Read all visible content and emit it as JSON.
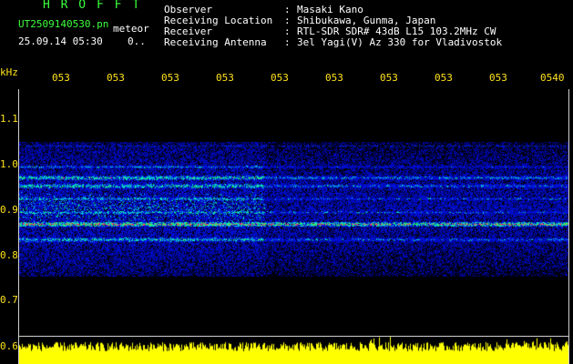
{
  "header": {
    "app_title": "H R O F F T",
    "filename": "UT2509140530.pn",
    "type_label": "meteor",
    "timestamp": "25.09.14 05:30",
    "count_label": "0..",
    "fields": [
      {
        "label": "Observer",
        "colon": ":",
        "value": "Masaki Kano"
      },
      {
        "label": "Receiving Location",
        "colon": ":",
        "value": "Shibukawa, Gunma, Japan"
      },
      {
        "label": "Receiver",
        "colon": ":",
        "value": "RTL-SDR SDR# 43dB L15 103.2MHz CW"
      },
      {
        "label": "Receiving Antenna",
        "colon": ":",
        "value": "3el Yagi(V) Az 330 for Vladivostok"
      }
    ]
  },
  "time_axis": {
    "labels": [
      "053",
      "053",
      "053",
      "053",
      "053",
      "053",
      "053",
      "053",
      "053",
      "0540"
    ]
  },
  "freq_axis": {
    "unit": "kHz",
    "ticks": [
      "1.1",
      "1.0",
      "0.9",
      "0.8",
      "0.7",
      "0.6"
    ]
  },
  "colors": {
    "header_green": "#3cff3c",
    "header_white": "#ffffff",
    "axis_yellow": "#ffe21a",
    "signal_red": "#ff2a5a",
    "amplitude_yellow": "#ffff00"
  }
}
